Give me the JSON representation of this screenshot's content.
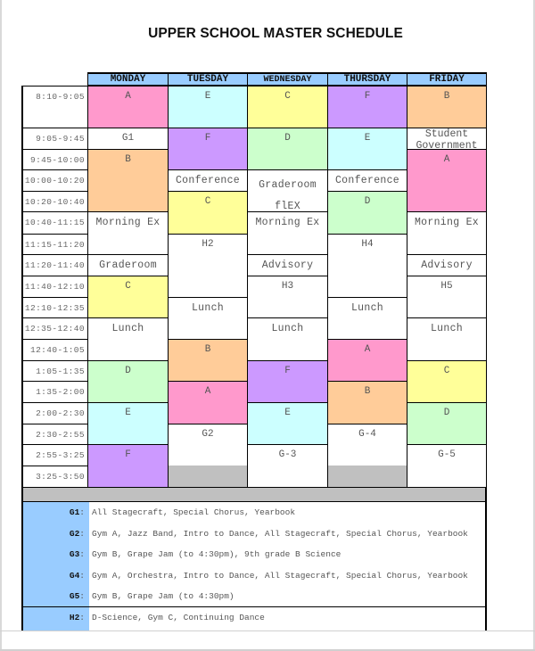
{
  "title": "UPPER SCHOOL MASTER SCHEDULE",
  "colors": {
    "header": "#99ccff",
    "A": "#ff99cc",
    "B": "#ffcc99",
    "C": "#ffff99",
    "D": "#ccffcc",
    "E": "#ccffff",
    "F": "#cc99ff",
    "white": "#ffffff",
    "gray": "#c0c0c0"
  },
  "days": [
    "MONDAY",
    "TUESDAY",
    "WEDNESDAY",
    "THURSDAY",
    "FRIDAY"
  ],
  "times": [
    "8:10-9:05",
    "9:05-9:45",
    "9:45-10:00",
    "10:00-10:20",
    "10:20-10:40",
    "10:40-11:15",
    "11:15-11:20",
    "11:20-11:40",
    "11:40-12:10",
    "12:10-12:35",
    "12:35-12:40",
    "12:40-1:05",
    "1:05-1:35",
    "1:35-2:00",
    "2:00-2:30",
    "2:30-2:55",
    "2:55-3:25",
    "3:25-3:50"
  ],
  "schedule": [
    [
      {
        "label": "A",
        "start": 0,
        "span": 1,
        "color": "A"
      },
      {
        "label": "G1",
        "start": 1,
        "span": 1,
        "color": "white"
      },
      {
        "label": "B",
        "start": 2,
        "span": 3,
        "color": "B"
      },
      {
        "label": "Morning Ex",
        "start": 5,
        "span": 2,
        "color": "white"
      },
      {
        "label": "Graderoom",
        "start": 7,
        "span": 1,
        "color": "white"
      },
      {
        "label": "C",
        "start": 8,
        "span": 2,
        "color": "C"
      },
      {
        "label": "Lunch",
        "start": 10,
        "span": 2,
        "color": "white"
      },
      {
        "label": "D",
        "start": 12,
        "span": 2,
        "color": "D"
      },
      {
        "label": "E",
        "start": 14,
        "span": 2,
        "color": "E"
      },
      {
        "label": "F",
        "start": 16,
        "span": 2,
        "color": "F"
      }
    ],
    [
      {
        "label": "E",
        "start": 0,
        "span": 1,
        "color": "E"
      },
      {
        "label": "F",
        "start": 1,
        "span": 2,
        "color": "F"
      },
      {
        "label": "Conference",
        "start": 3,
        "span": 1,
        "color": "white"
      },
      {
        "label": "C",
        "start": 4,
        "span": 2,
        "color": "C"
      },
      {
        "label": "H2",
        "start": 6,
        "span": 3,
        "color": "white"
      },
      {
        "label": "Lunch",
        "start": 9,
        "span": 2,
        "color": "white"
      },
      {
        "label": "B",
        "start": 11,
        "span": 2,
        "color": "B"
      },
      {
        "label": "A",
        "start": 13,
        "span": 2,
        "color": "A"
      },
      {
        "label": "G2",
        "start": 15,
        "span": 2,
        "color": "white"
      },
      {
        "label": "",
        "start": 17,
        "span": 1,
        "color": "gray"
      }
    ],
    [
      {
        "label": "C",
        "start": 0,
        "span": 1,
        "color": "C"
      },
      {
        "label": "D",
        "start": 1,
        "span": 2,
        "color": "D"
      },
      {
        "label": "Graderoom\nflEX",
        "start": 3,
        "span": 2,
        "color": "white"
      },
      {
        "label": "Morning Ex",
        "start": 5,
        "span": 2,
        "color": "white"
      },
      {
        "label": "Advisory",
        "start": 7,
        "span": 1,
        "color": "white"
      },
      {
        "label": "H3",
        "start": 8,
        "span": 2,
        "color": "white"
      },
      {
        "label": "Lunch",
        "start": 10,
        "span": 2,
        "color": "white"
      },
      {
        "label": "F",
        "start": 12,
        "span": 2,
        "color": "F"
      },
      {
        "label": "E",
        "start": 14,
        "span": 2,
        "color": "E"
      },
      {
        "label": "G-3",
        "start": 16,
        "span": 2,
        "color": "white"
      }
    ],
    [
      {
        "label": "F",
        "start": 0,
        "span": 1,
        "color": "F"
      },
      {
        "label": "E",
        "start": 1,
        "span": 2,
        "color": "E"
      },
      {
        "label": "Conference",
        "start": 3,
        "span": 1,
        "color": "white"
      },
      {
        "label": "D",
        "start": 4,
        "span": 2,
        "color": "D"
      },
      {
        "label": "H4",
        "start": 6,
        "span": 3,
        "color": "white"
      },
      {
        "label": "Lunch",
        "start": 9,
        "span": 2,
        "color": "white"
      },
      {
        "label": "A",
        "start": 11,
        "span": 2,
        "color": "A"
      },
      {
        "label": "B",
        "start": 13,
        "span": 2,
        "color": "B"
      },
      {
        "label": "G-4",
        "start": 15,
        "span": 2,
        "color": "white"
      },
      {
        "label": "",
        "start": 17,
        "span": 1,
        "color": "gray"
      }
    ],
    [
      {
        "label": "B",
        "start": 0,
        "span": 1,
        "color": "B"
      },
      {
        "label": "Student\nGovernment",
        "start": 1,
        "span": 1,
        "color": "white"
      },
      {
        "label": "A",
        "start": 2,
        "span": 3,
        "color": "A"
      },
      {
        "label": "Morning Ex",
        "start": 5,
        "span": 2,
        "color": "white"
      },
      {
        "label": "Advisory",
        "start": 7,
        "span": 1,
        "color": "white"
      },
      {
        "label": "H5",
        "start": 8,
        "span": 2,
        "color": "white"
      },
      {
        "label": "Lunch",
        "start": 10,
        "span": 2,
        "color": "white"
      },
      {
        "label": "C",
        "start": 12,
        "span": 2,
        "color": "C"
      },
      {
        "label": "D",
        "start": 14,
        "span": 2,
        "color": "D"
      },
      {
        "label": "G-5",
        "start": 16,
        "span": 2,
        "color": "white"
      }
    ]
  ],
  "legend_groups": [
    {
      "rows": [
        {
          "key": "G1",
          "text": "All Stagecraft, Special Chorus, Yearbook"
        },
        {
          "key": "G2",
          "text": "Gym A, Jazz Band, Intro to Dance, All Stagecraft, Special Chorus, Yearbook"
        },
        {
          "key": "G3",
          "text": "Gym B, Grape Jam (to 4:30pm), 9th grade B Science"
        },
        {
          "key": "G4",
          "text": "Gym A, Orchestra, Intro to Dance, All Stagecraft, Special Chorus, Yearbook"
        },
        {
          "key": "G5",
          "text": "Gym B, Grape Jam (to 4:30pm)"
        }
      ]
    },
    {
      "rows": [
        {
          "key": "H2",
          "text": "D-Science, Gym C, Continuing Dance"
        }
      ]
    }
  ]
}
